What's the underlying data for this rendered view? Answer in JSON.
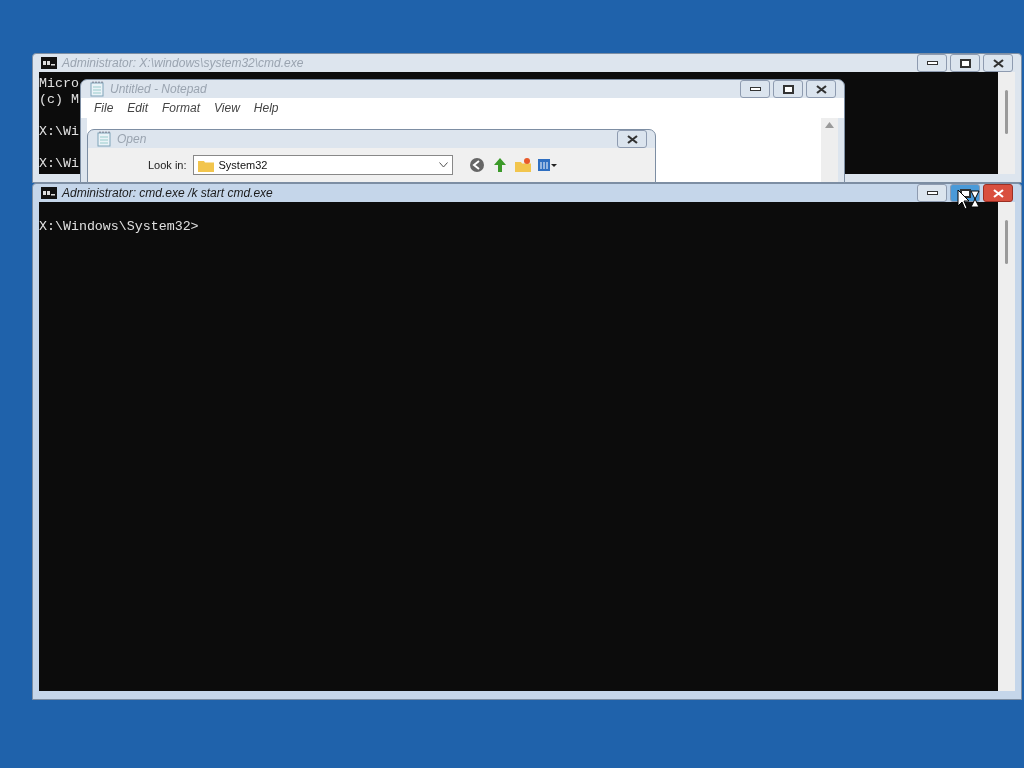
{
  "windows": [
    {
      "kind": "console",
      "title": "Administrator: X:\\windows\\system32\\cmd.exe",
      "active": false,
      "lines": [
        "Micro",
        "(c) M",
        "X:\\Wi",
        "X:\\Wi"
      ]
    },
    {
      "kind": "notepad",
      "title": "Untitled - Notepad",
      "active": false,
      "menu": [
        "File",
        "Edit",
        "Format",
        "View",
        "Help"
      ]
    },
    {
      "kind": "open_dialog",
      "title": "Open",
      "active": false,
      "look_in_label": "Look in:",
      "look_in_value": "System32"
    },
    {
      "kind": "console",
      "title": "Administrator: cmd.exe /k start cmd.exe",
      "active": true,
      "lines": [
        "X:\\Windows\\System32>"
      ]
    }
  ]
}
